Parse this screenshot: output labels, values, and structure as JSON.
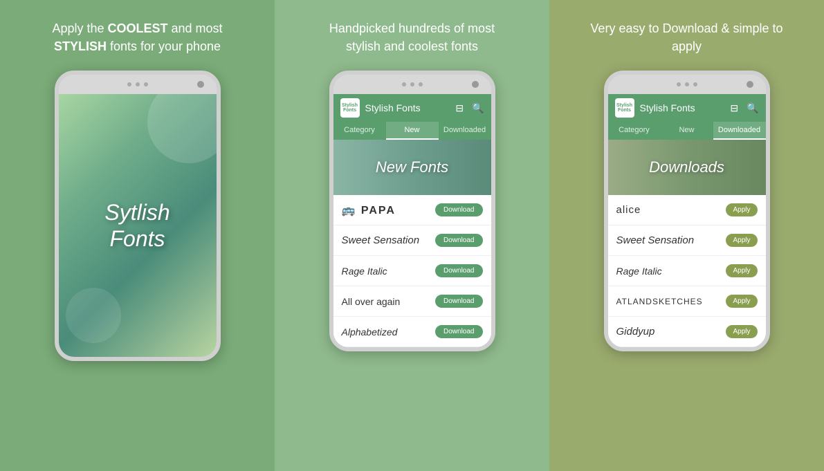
{
  "panels": [
    {
      "id": "panel-1",
      "tagline": "Apply the COOLEST and most STYLISH fonts for your phone",
      "type": "splash"
    },
    {
      "id": "panel-2",
      "tagline": "Handpicked hundreds of most stylish and coolest fonts",
      "type": "new-fonts"
    },
    {
      "id": "panel-3",
      "tagline": "Very easy to Download & simple to apply",
      "type": "downloaded"
    }
  ],
  "app": {
    "title": "Stylish Fonts",
    "logo_line1": "Stylish",
    "logo_line2": "Fonts",
    "tabs": [
      "Category",
      "New",
      "Downloaded"
    ],
    "banner_new": "New Fonts",
    "banner_downloads": "Downloads",
    "fonts_new": [
      {
        "name": "🚌 PAPA",
        "style": "font-papa"
      },
      {
        "name": "Sweet Sensation",
        "style": "font-sweet"
      },
      {
        "name": "Rage Italic",
        "style": "font-rage"
      },
      {
        "name": "All over again",
        "style": "font-allover"
      },
      {
        "name": "Alphabetized",
        "style": "font-alpha"
      }
    ],
    "fonts_downloaded": [
      {
        "name": "alice",
        "style": "font-alice"
      },
      {
        "name": "Sweet Sensation",
        "style": "font-sweet"
      },
      {
        "name": "Rage Italic",
        "style": "font-rage"
      },
      {
        "name": "ATLANDSKETCHES",
        "style": "font-atland"
      },
      {
        "name": "Giddyup",
        "style": "font-giddyup"
      }
    ],
    "btn_download": "Download",
    "btn_apply": "Apply"
  },
  "splash": {
    "title_line1": "Sytlish",
    "title_line2": "Fonts"
  }
}
